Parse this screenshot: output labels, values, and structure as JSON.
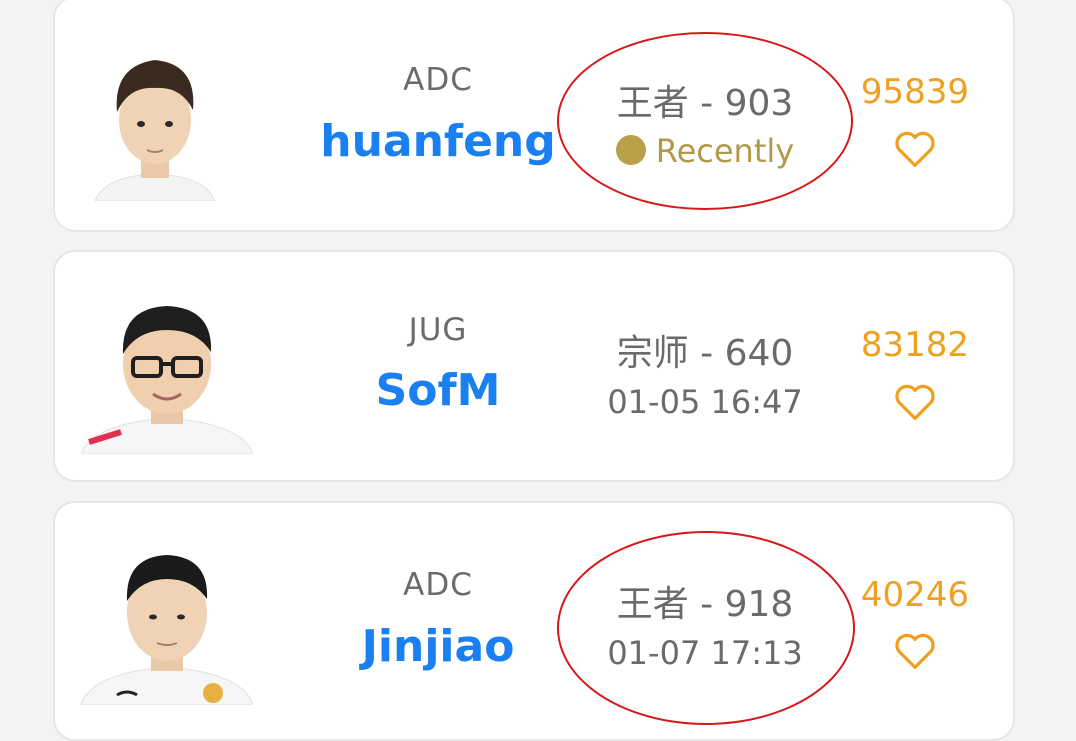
{
  "players": [
    {
      "role": "ADC",
      "name": "huanfeng",
      "rank": "王者 - 903",
      "status": "Recently",
      "likes": "95839"
    },
    {
      "role": "JUG",
      "name": "SofM",
      "rank": "宗师 - 640",
      "status": "01-05 16:47",
      "likes": "83182"
    },
    {
      "role": "ADC",
      "name": "Jinjiao",
      "rank": "王者 - 918",
      "status": "01-07 17:13",
      "likes": "40246"
    }
  ],
  "icons": {
    "like": "heart-outline-icon",
    "online": "status-dot-icon"
  },
  "colors": {
    "name": "#1a7ff0",
    "likes": "#f0a020",
    "recent": "#b8a048",
    "annotation": "#d81818"
  }
}
